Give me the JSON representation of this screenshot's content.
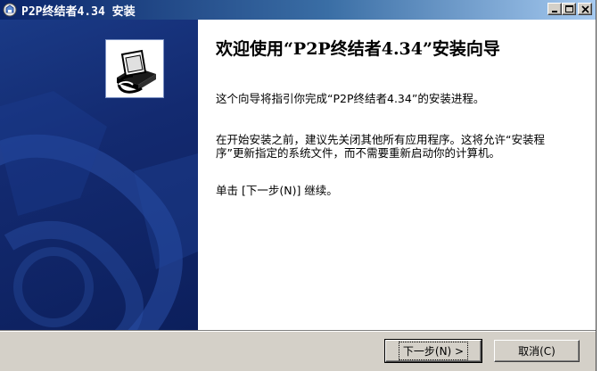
{
  "window": {
    "title": "P2P终结者4.34 安装"
  },
  "content": {
    "heading": "欢迎使用“P2P终结者4.34”安装向导",
    "paragraph1": "这个向导将指引你完成“P2P终结者4.34”的安装进程。",
    "paragraph2": "在开始安装之前，建议先关闭其他所有应用程序。这将允许“安装程序”更新指定的系统文件，而不需要重新启动你的计算机。",
    "paragraph3": "单击 [下一步(N)] 继续。"
  },
  "buttons": {
    "next_label": "下一步(N) >",
    "cancel_label": "取消(C)"
  },
  "icons": {
    "app": "installer-app-icon",
    "banner": "installer-box-icon",
    "minimize": "minimize-icon",
    "maximize": "maximize-icon",
    "close": "close-icon"
  },
  "colors": {
    "titlebar_start": "#0a246a",
    "titlebar_end": "#a6caf0",
    "banner": "#132a70",
    "face": "#d4d0c8"
  }
}
